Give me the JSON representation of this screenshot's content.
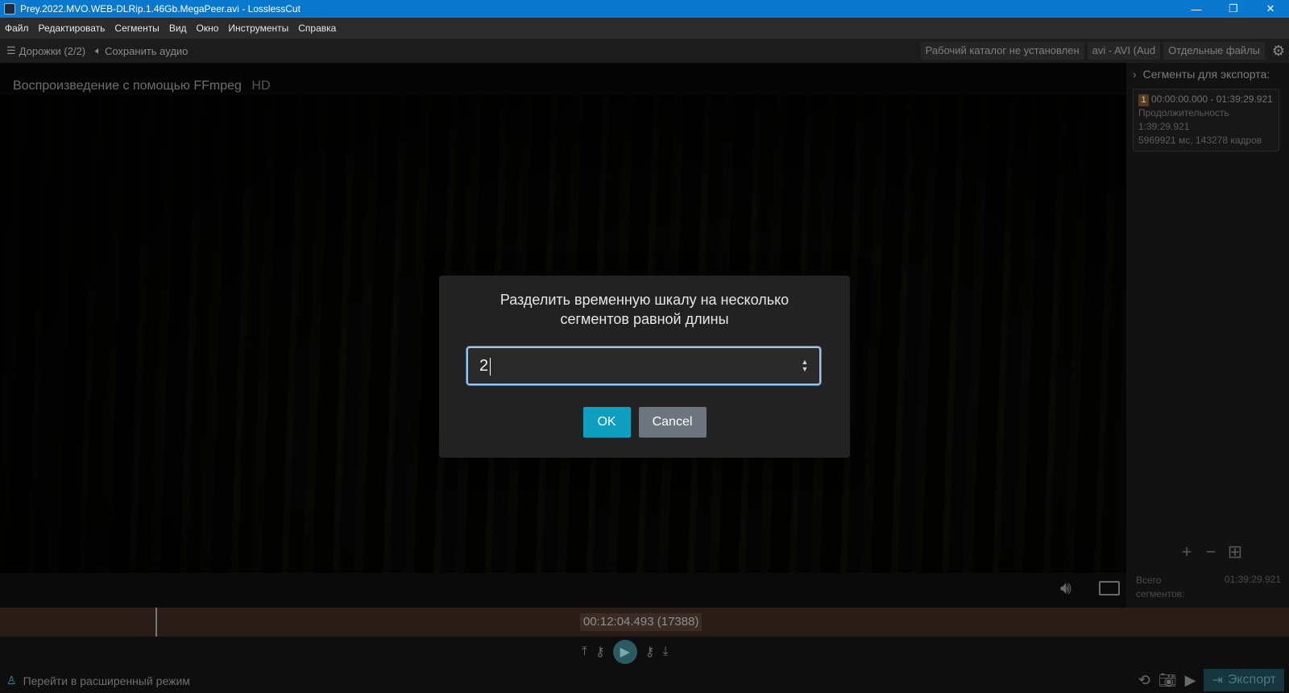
{
  "window": {
    "title": "Prey.2022.MVO.WEB-DLRip.1.46Gb.MegaPeer.avi - LosslessCut",
    "controls": {
      "minimize": "—",
      "restore": "❐",
      "close": "✕"
    }
  },
  "menu": {
    "items": [
      "Файл",
      "Редактировать",
      "Сегменты",
      "Вид",
      "Окно",
      "Инструменты",
      "Справка"
    ]
  },
  "toolbar": {
    "tracks_label": "Дорожки (2/2)",
    "save_audio_label": "Сохранить аудио",
    "working_dir_label": "Рабочий каталог не установлен",
    "format_select": "avi - AVI (Aud",
    "output_mode_select": "Отдельные файлы"
  },
  "player": {
    "playback_label": "Воспроизведение с помощью FFmpeg",
    "quality_badge": "HD"
  },
  "segments_panel": {
    "header": "Сегменты для экспорта:",
    "segment": {
      "number": "1",
      "time_range": "00:00:00.000 - 01:39:29.921",
      "duration_label": "Продолжительность",
      "duration_value": "1:39:29.921",
      "details": "5969921 мс, 143278 кадров"
    },
    "total_label_1": "Всего",
    "total_label_2": "сегментов:",
    "total_value": "01:39:29.921"
  },
  "timeline": {
    "timecode": "00:12:04.493 (17388)"
  },
  "bottom": {
    "advanced_mode_label": "Перейти в расширенный режим",
    "export_label": "Экспорт"
  },
  "dialog": {
    "title_line1": "Разделить временную шкалу на несколько",
    "title_line2": "сегментов равной длины",
    "input_value": "2",
    "ok_label": "OK",
    "cancel_label": "Cancel"
  },
  "colors": {
    "titlebar": "#0b78d0",
    "ok_button": "#0e9ec0",
    "cancel_button": "#6c757d",
    "timeline": "#2a1d17"
  }
}
